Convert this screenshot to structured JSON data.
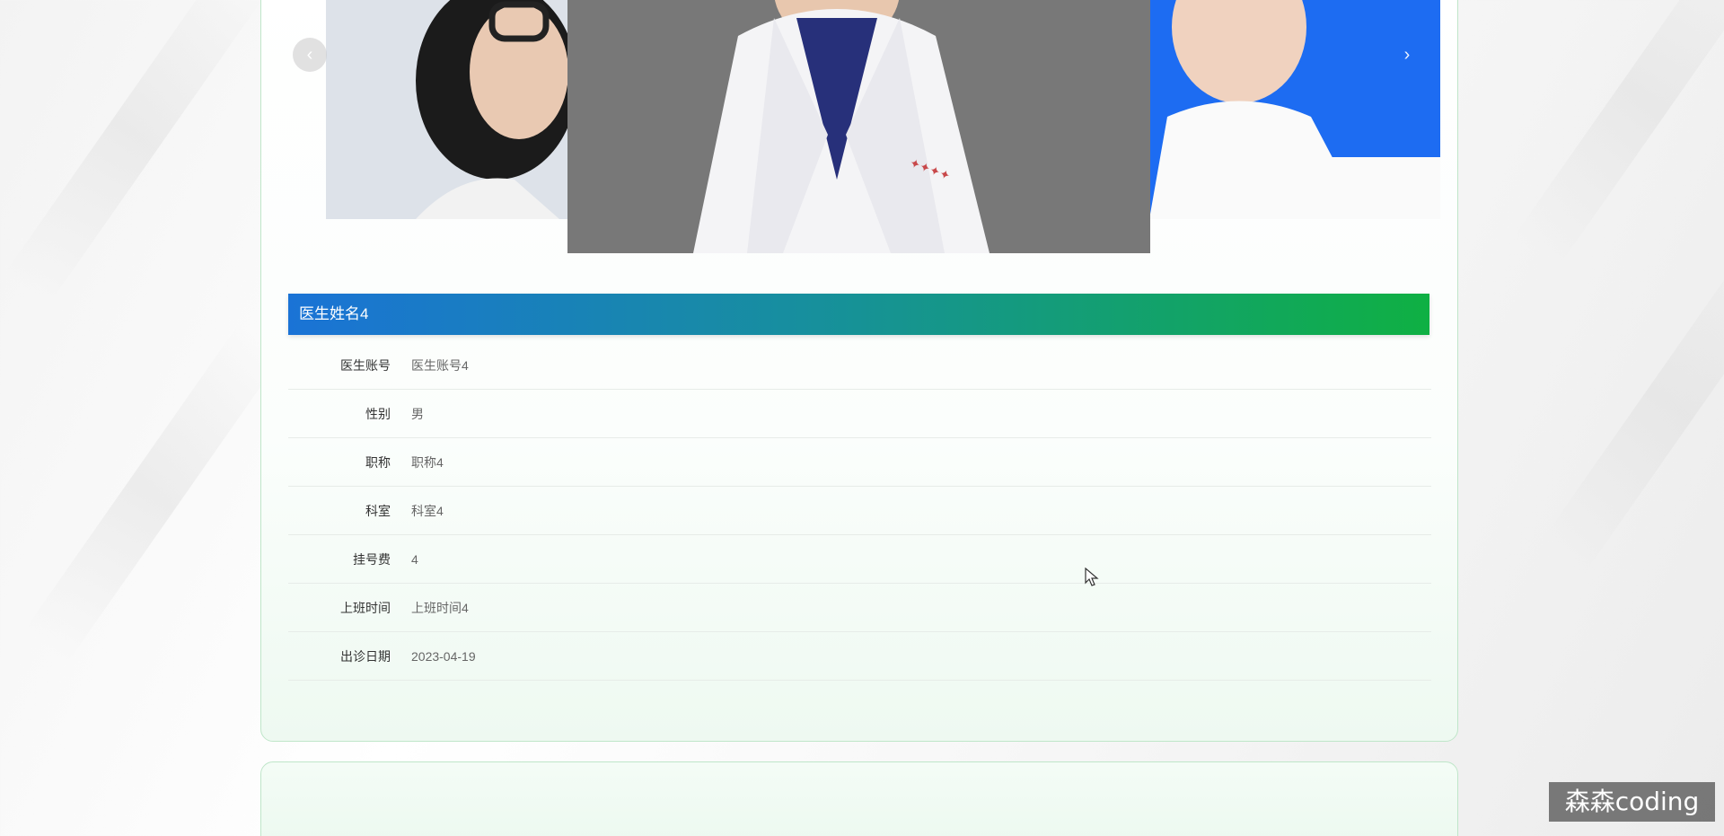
{
  "carousel": {
    "prev_icon": "chevron-left-icon",
    "next_icon": "chevron-right-icon",
    "prev_glyph": "‹",
    "next_glyph": "›"
  },
  "doctor": {
    "name_title": "医生姓名4",
    "fields": [
      {
        "label": "医生账号",
        "value": "医生账号4"
      },
      {
        "label": "性别",
        "value": "男"
      },
      {
        "label": "职称",
        "value": "职称4"
      },
      {
        "label": "科室",
        "value": "科室4"
      },
      {
        "label": "挂号费",
        "value": "4"
      },
      {
        "label": "上班时间",
        "value": "上班时间4"
      },
      {
        "label": "出诊日期",
        "value": "2023-04-19"
      }
    ]
  },
  "watermark": {
    "text": "森森coding"
  },
  "colors": {
    "title_gradient_start": "#1a73d6",
    "title_gradient_end": "#0fb043",
    "card_border": "#bfe6c9"
  }
}
